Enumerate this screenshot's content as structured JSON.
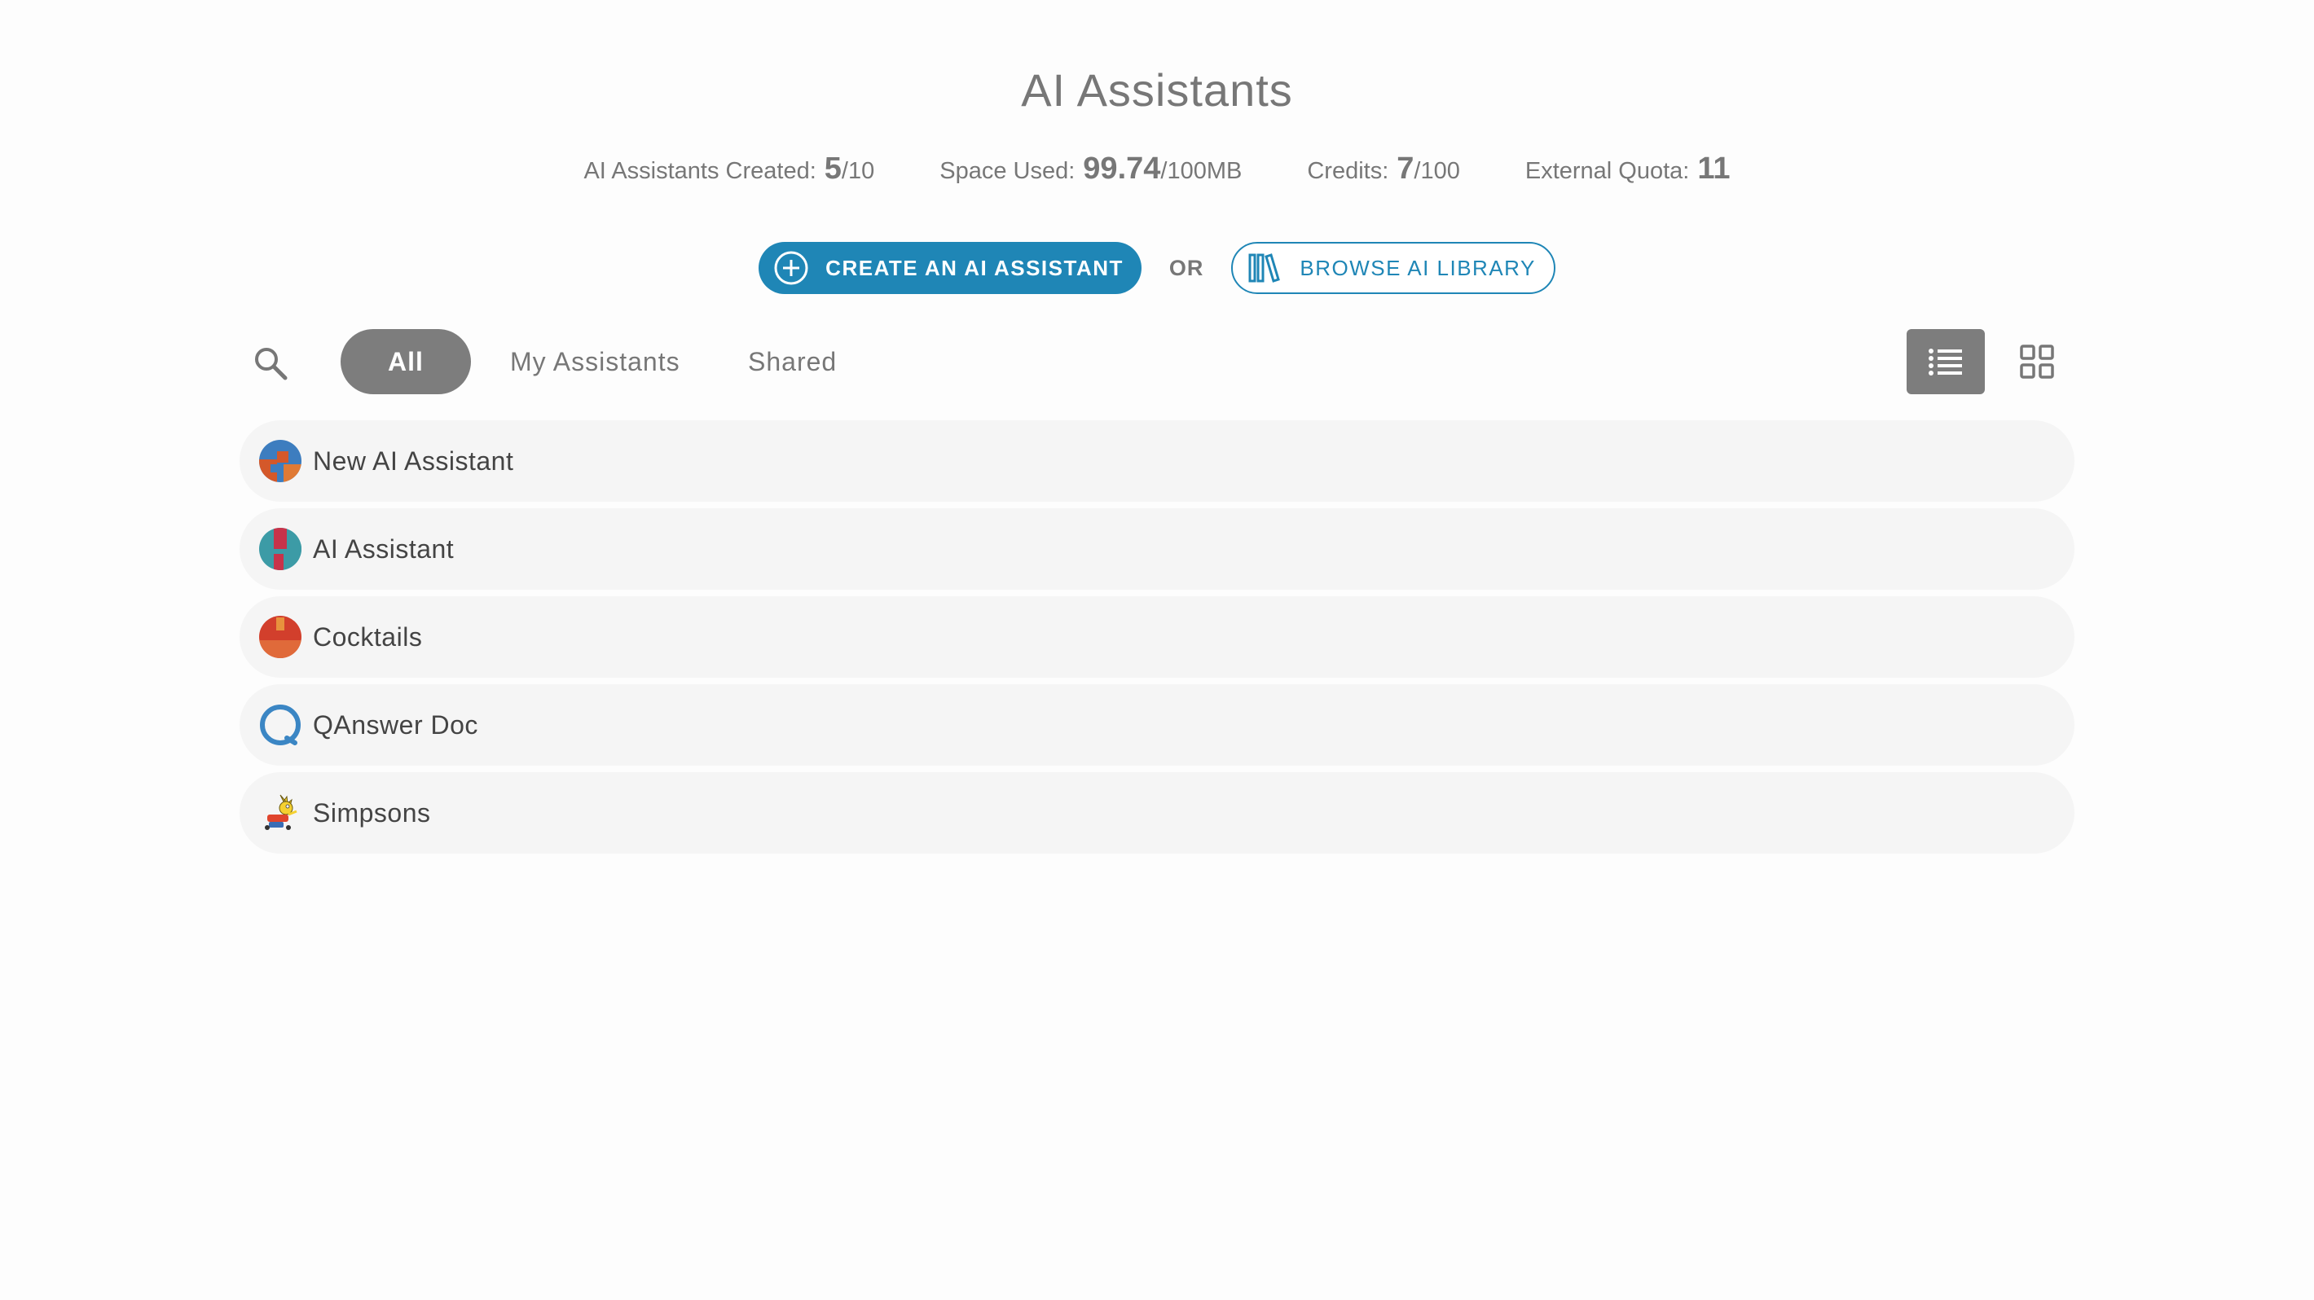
{
  "header": {
    "title": "AI Assistants"
  },
  "stats": [
    {
      "label": "AI Assistants Created:",
      "value": "5",
      "suffix": "/10"
    },
    {
      "label": "Space Used:",
      "value": "99.74",
      "suffix": "/100MB"
    },
    {
      "label": "Credits:",
      "value": "7",
      "suffix": "/100"
    },
    {
      "label": "External Quota:",
      "value": "11",
      "suffix": ""
    }
  ],
  "actions": {
    "create_label": "CREATE AN AI ASSISTANT",
    "or_label": "OR",
    "browse_label": "BROWSE AI LIBRARY"
  },
  "filters": {
    "tabs": [
      {
        "label": "All",
        "active": true
      },
      {
        "label": "My Assistants",
        "active": false
      },
      {
        "label": "Shared",
        "active": false
      }
    ],
    "view_mode": "list"
  },
  "assistants": [
    {
      "name": "New AI Assistant",
      "icon": "quilt-avatar-icon"
    },
    {
      "name": "AI Assistant",
      "icon": "quilt-avatar-icon"
    },
    {
      "name": "Cocktails",
      "icon": "cocktails-avatar-icon"
    },
    {
      "name": "QAnswer Doc",
      "icon": "ring-avatar-icon"
    },
    {
      "name": "Simpsons",
      "icon": "simpsons-avatar-icon"
    }
  ],
  "colors": {
    "accent": "#1f86b6",
    "active_tab": "#7d7d7d",
    "row_bg": "#f5f5f5"
  }
}
